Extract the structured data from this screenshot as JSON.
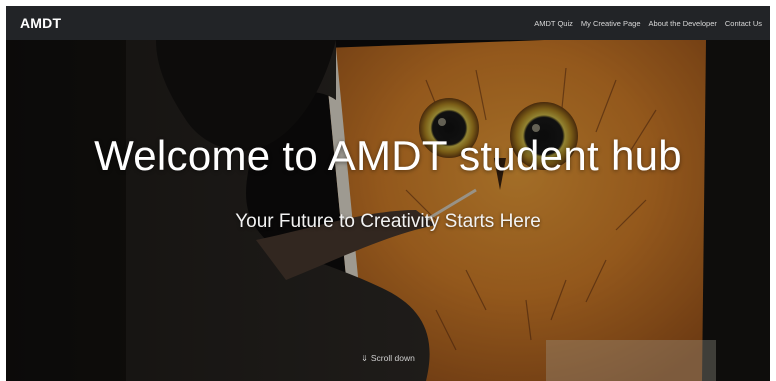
{
  "nav": {
    "brand": "AMDT",
    "links": [
      {
        "label": "AMDT Quiz"
      },
      {
        "label": "My Creative Page"
      },
      {
        "label": "About the Developer"
      },
      {
        "label": "Contact Us"
      }
    ]
  },
  "hero": {
    "title": "Welcome to AMDT student hub",
    "subtitle": "Your Future to Creativity Starts Here",
    "scroll_icon": "⇓",
    "scroll_label": "Scroll down"
  },
  "colors": {
    "navbar": "#222427",
    "hero_text": "#ffffff"
  }
}
